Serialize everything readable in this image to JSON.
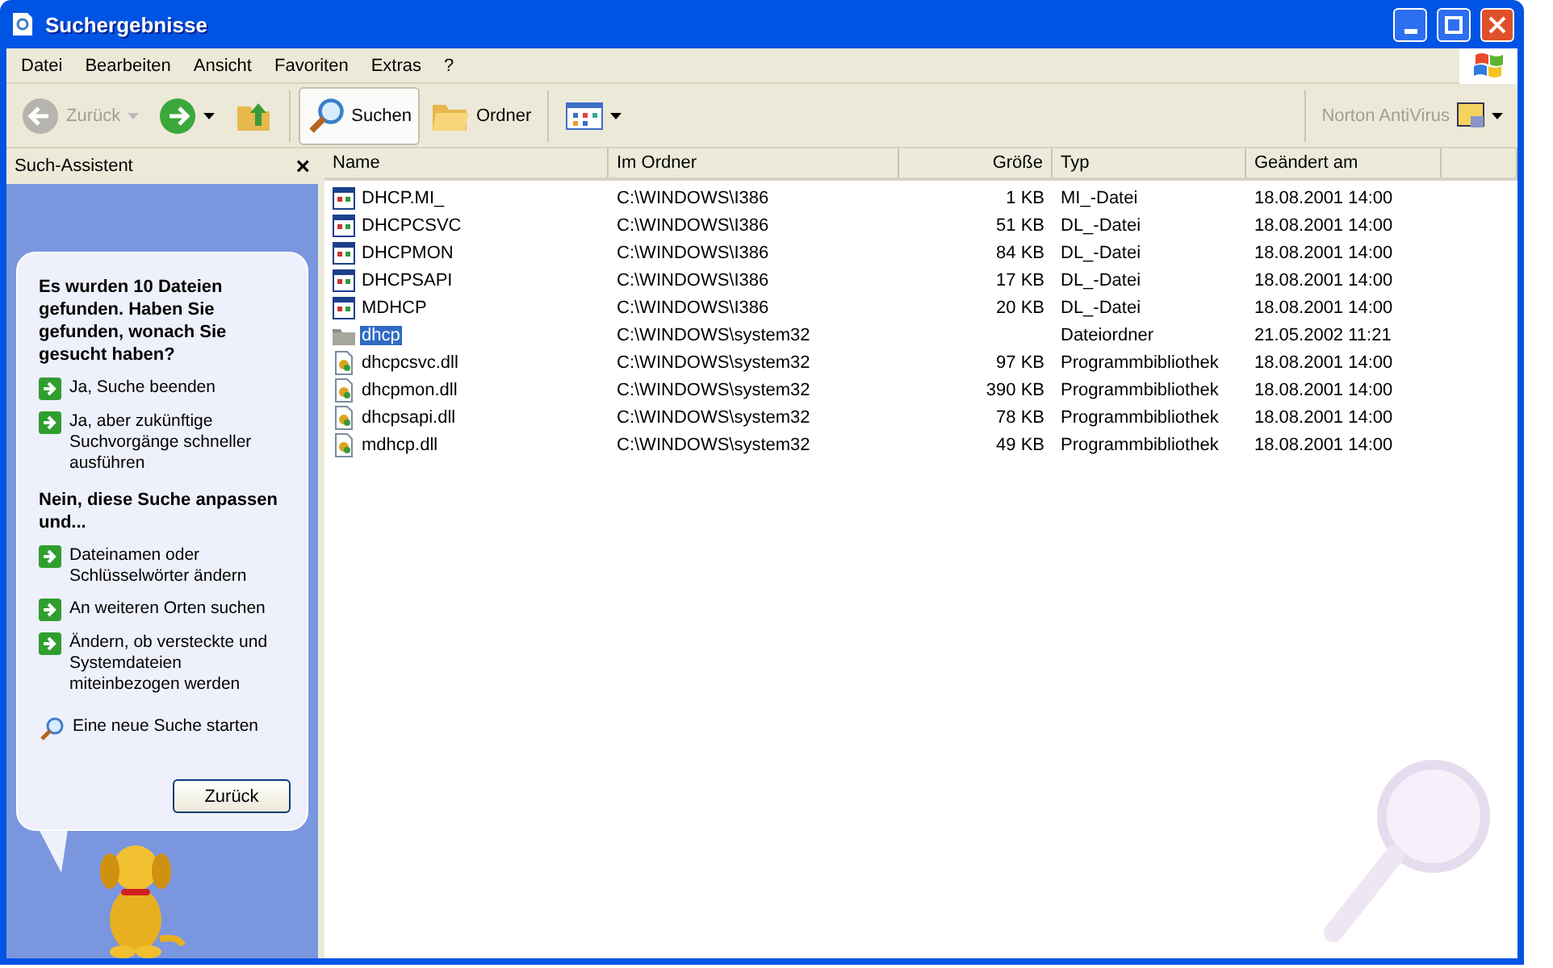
{
  "window": {
    "title": "Suchergebnisse"
  },
  "menu": [
    "Datei",
    "Bearbeiten",
    "Ansicht",
    "Favoriten",
    "Extras",
    "?"
  ],
  "toolbar": {
    "back": {
      "label": "Zurück",
      "disabled": true
    },
    "forward": {
      "disabled": false
    },
    "buttons": [
      {
        "label": "Suchen",
        "kind": "search",
        "selected": true
      },
      {
        "label": "Ordner",
        "kind": "folders",
        "selected": false
      }
    ],
    "addon": {
      "label": "Norton AntiVirus"
    }
  },
  "sidebar": {
    "title": "Such-Assistent",
    "close": "×",
    "question": "Es wurden 10 Dateien gefunden. Haben Sie gefunden, wonach Sie gesucht haben?",
    "links_yes": [
      {
        "label": "Ja, Suche beenden",
        "kind": "arrow"
      },
      {
        "label": "Ja, aber zukünftige Suchvorgänge schneller ausführen",
        "kind": "arrow"
      }
    ],
    "heading_no": "Nein, diese Suche anpassen und...",
    "links_no": [
      {
        "label": "Dateinamen oder Schlüsselwörter ändern",
        "kind": "arrow"
      },
      {
        "label": "An weiteren Orten suchen",
        "kind": "arrow"
      },
      {
        "label": "Ändern, ob versteckte und Systemdateien miteinbezogen werden",
        "kind": "arrow"
      },
      {
        "label": "Eine neue Suche starten",
        "kind": "search"
      }
    ],
    "back_button": "Zurück"
  },
  "table": {
    "columns": [
      "Name",
      "Im Ordner",
      "Größe",
      "Typ",
      "Geändert am"
    ],
    "rows": [
      {
        "kind": "setup",
        "name": "DHCP.MI_",
        "folder": "C:\\WINDOWS\\I386",
        "size": "1 KB",
        "type": "MI_-Datei",
        "modified": "18.08.2001 14:00",
        "selected": false
      },
      {
        "kind": "setup",
        "name": "DHCPCSVC",
        "folder": "C:\\WINDOWS\\I386",
        "size": "51 KB",
        "type": "DL_-Datei",
        "modified": "18.08.2001 14:00",
        "selected": false
      },
      {
        "kind": "setup",
        "name": "DHCPMON",
        "folder": "C:\\WINDOWS\\I386",
        "size": "84 KB",
        "type": "DL_-Datei",
        "modified": "18.08.2001 14:00",
        "selected": false
      },
      {
        "kind": "setup",
        "name": "DHCPSAPI",
        "folder": "C:\\WINDOWS\\I386",
        "size": "17 KB",
        "type": "DL_-Datei",
        "modified": "18.08.2001 14:00",
        "selected": false
      },
      {
        "kind": "setup",
        "name": "MDHCP",
        "folder": "C:\\WINDOWS\\I386",
        "size": "20 KB",
        "type": "DL_-Datei",
        "modified": "18.08.2001 14:00",
        "selected": false
      },
      {
        "kind": "folder",
        "name": "dhcp",
        "folder": "C:\\WINDOWS\\system32",
        "type": "Dateiordner",
        "modified": "21.05.2002 11:21",
        "selected": true
      },
      {
        "kind": "dll",
        "name": "dhcpcsvc.dll",
        "folder": "C:\\WINDOWS\\system32",
        "size": "97 KB",
        "type": "Programmbibliothek",
        "modified": "18.08.2001 14:00",
        "selected": false
      },
      {
        "kind": "dll",
        "name": "dhcpmon.dll",
        "folder": "C:\\WINDOWS\\system32",
        "size": "390 KB",
        "type": "Programmbibliothek",
        "modified": "18.08.2001 14:00",
        "selected": false
      },
      {
        "kind": "dll",
        "name": "dhcpsapi.dll",
        "folder": "C:\\WINDOWS\\system32",
        "size": "78 KB",
        "type": "Programmbibliothek",
        "modified": "18.08.2001 14:00",
        "selected": false
      },
      {
        "kind": "dll",
        "name": "mdhcp.dll",
        "folder": "C:\\WINDOWS\\system32",
        "size": "49 KB",
        "type": "Programmbibliothek",
        "modified": "18.08.2001 14:00",
        "selected": false
      }
    ]
  }
}
